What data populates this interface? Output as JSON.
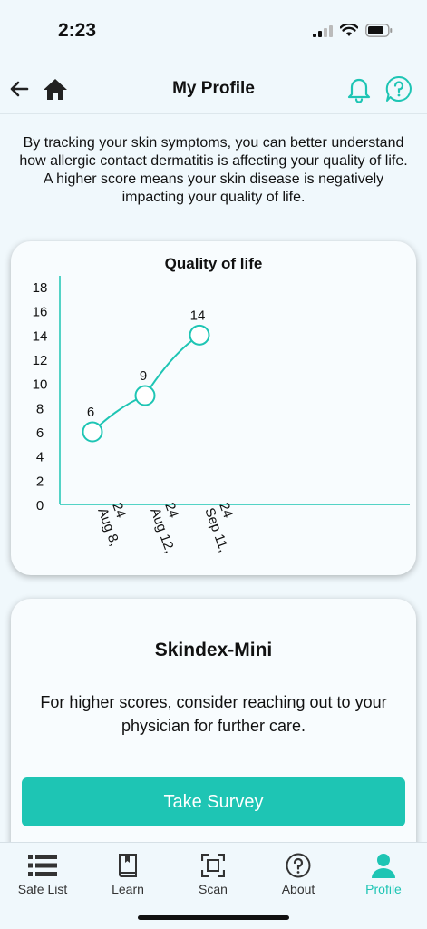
{
  "status_bar": {
    "time": "2:23"
  },
  "header": {
    "title": "My Profile"
  },
  "intro_text": "By tracking your skin symptoms, you can better understand how allergic contact dermatitis is affecting your quality of life. A higher score means your skin disease is negatively impacting your quality of life.",
  "chart_data": {
    "type": "line",
    "title": "Quality of life",
    "x": [
      "Aug 8, 24",
      "Aug 12, 24",
      "Sep 11, 24"
    ],
    "x_label_lines": [
      [
        "Aug 8,",
        "24"
      ],
      [
        "Aug 12,",
        "24"
      ],
      [
        "Sep 11,",
        "24"
      ]
    ],
    "series": [
      {
        "values": [
          6,
          9,
          14
        ]
      }
    ],
    "data_labels": [
      "6",
      "9",
      "14"
    ],
    "y_ticks": [
      "0",
      "2",
      "4",
      "6",
      "8",
      "10",
      "12",
      "14",
      "16",
      "18"
    ],
    "ylim": [
      0,
      18
    ],
    "grid": false,
    "color": "#1ec5b4"
  },
  "survey": {
    "title": "Skindex-Mini",
    "text": "For higher scores, consider reaching out to your physician for further care.",
    "button_label": "Take Survey"
  },
  "tabs": [
    {
      "label": "Safe List",
      "icon": "list-icon"
    },
    {
      "label": "Learn",
      "icon": "book-icon"
    },
    {
      "label": "Scan",
      "icon": "scan-icon"
    },
    {
      "label": "About",
      "icon": "question-circle-icon"
    },
    {
      "label": "Profile",
      "icon": "person-icon",
      "active": true
    }
  ],
  "colors": {
    "accent": "#1ec5b4",
    "background": "#f0f8fc"
  }
}
